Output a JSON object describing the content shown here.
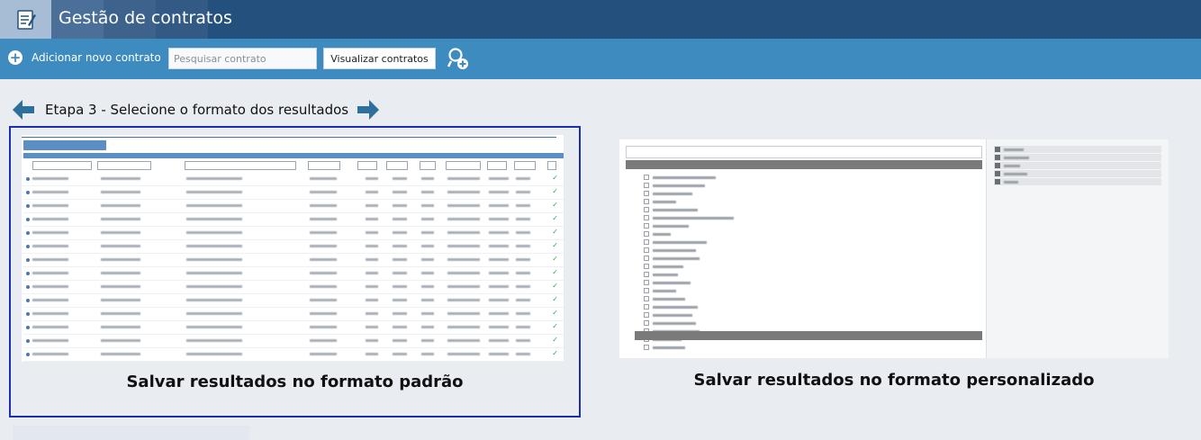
{
  "header": {
    "title": "Gestão de contratos",
    "colors": {
      "bar": "#24507e",
      "logo_bg": "#a7bcd5"
    }
  },
  "toolbar": {
    "add_label": "Adicionar novo contrato",
    "search": {
      "placeholder": "Pesquisar contrato",
      "value": ""
    },
    "view_button": "Visualizar contratos",
    "advanced_search_icon": "search-plus-icon",
    "color": "#3e8bbf"
  },
  "step": {
    "label": "Etapa 3 - Selecione o formato dos resultados",
    "prev_icon": "arrow-left-icon",
    "next_icon": "arrow-right-icon"
  },
  "options": [
    {
      "id": "default",
      "caption": "Salvar resultados no formato padrão",
      "selected": true
    },
    {
      "id": "custom",
      "caption": "Salvar resultados no formato personalizado",
      "selected": false
    }
  ],
  "colors": {
    "selected_border": "#1c2fae",
    "page_bg": "#e9ecf1"
  }
}
